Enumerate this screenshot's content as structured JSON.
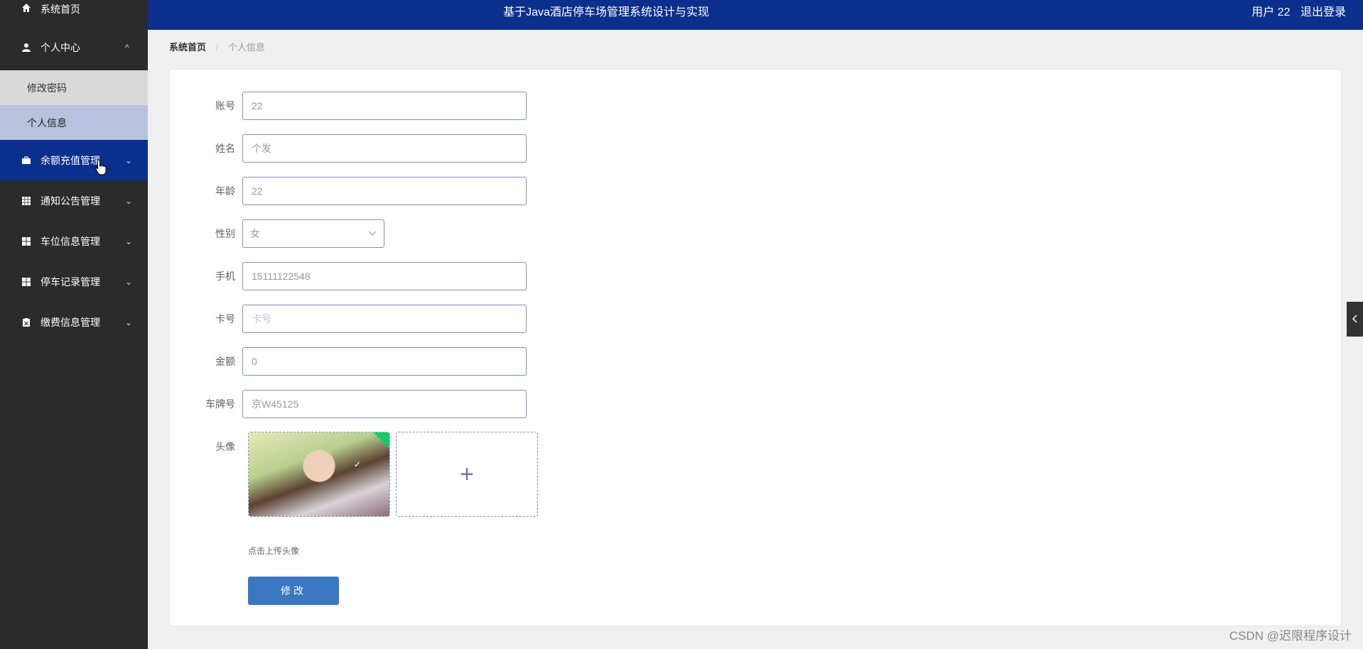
{
  "header": {
    "title": "基于Java酒店停车场管理系统设计与实现",
    "user_label": "用户 22",
    "logout_label": "退出登录"
  },
  "sidebar": {
    "items": [
      {
        "label": "系统首页",
        "icon": "home-icon"
      },
      {
        "label": "个人中心",
        "icon": "user-icon",
        "arrow": "^"
      },
      {
        "label": "修改密码"
      },
      {
        "label": "个人信息"
      },
      {
        "label": "余额充值管理",
        "icon": "briefcase-icon",
        "arrow": "⌄"
      },
      {
        "label": "通知公告管理",
        "icon": "grid-icon",
        "arrow": "⌄"
      },
      {
        "label": "车位信息管理",
        "icon": "apps-icon",
        "arrow": "⌄"
      },
      {
        "label": "停车记录管理",
        "icon": "apps-icon",
        "arrow": "⌄"
      },
      {
        "label": "缴费信息管理",
        "icon": "clipboard-icon",
        "arrow": "⌄"
      }
    ]
  },
  "breadcrumb": {
    "home": "系统首页",
    "current": "个人信息",
    "sep": "/"
  },
  "form": {
    "account": {
      "label": "账号",
      "value": "22"
    },
    "name": {
      "label": "姓名",
      "value": "个发"
    },
    "age": {
      "label": "年龄",
      "value": "22"
    },
    "gender": {
      "label": "性别",
      "value": "女"
    },
    "phone": {
      "label": "手机",
      "value": "15111122548"
    },
    "card": {
      "label": "卡号",
      "placeholder": "卡号"
    },
    "balance": {
      "label": "金额",
      "value": "0"
    },
    "plate": {
      "label": "车牌号",
      "value": "京W45125"
    },
    "avatar": {
      "label": "头像",
      "hint": "点击上传头像",
      "plus": "+"
    },
    "submit_label": "修改"
  },
  "watermark": "CSDN @迟限程序设计",
  "colors": {
    "primary": "#0b2f8c",
    "sidebar": "#2b2b2b",
    "button": "#3a78c2"
  }
}
